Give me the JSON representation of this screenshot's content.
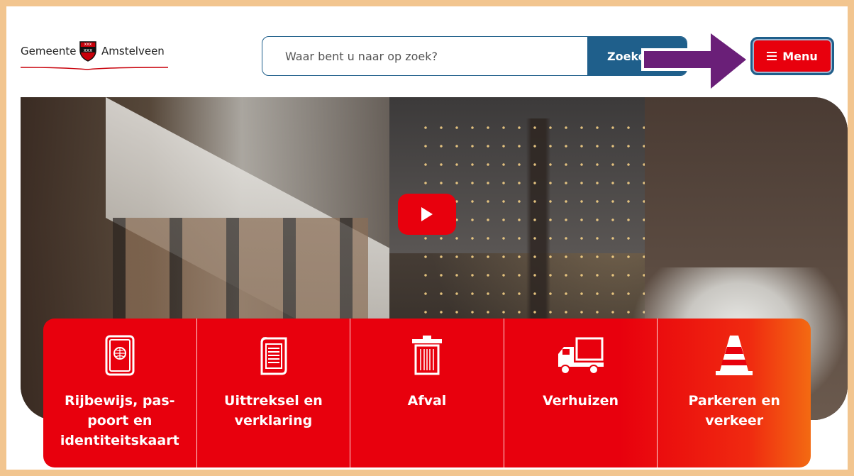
{
  "header": {
    "logo": {
      "left": "Gemeente",
      "right": "Amstelveen"
    },
    "search": {
      "placeholder": "Waar bent u naar op zoek?",
      "button_label": "Zoeken"
    },
    "menu": {
      "label": "Menu"
    }
  },
  "hero": {
    "play_icon": "play-icon"
  },
  "tiles": [
    {
      "label": "Rijbewijs, pas-poort en identiteitskaart",
      "icon": "passport-icon"
    },
    {
      "label": "Uittreksel en verklaring",
      "icon": "document-scroll-icon"
    },
    {
      "label": "Afval",
      "icon": "trash-bin-icon"
    },
    {
      "label": "Verhuizen",
      "icon": "moving-truck-icon"
    },
    {
      "label": "Parkeren en verkeer",
      "icon": "traffic-cone-icon"
    }
  ],
  "colors": {
    "brand_red": "#e8000d",
    "brand_blue": "#1f5f8b",
    "annotation_arrow": "#6a1f78",
    "frame": "#f2c58f"
  }
}
